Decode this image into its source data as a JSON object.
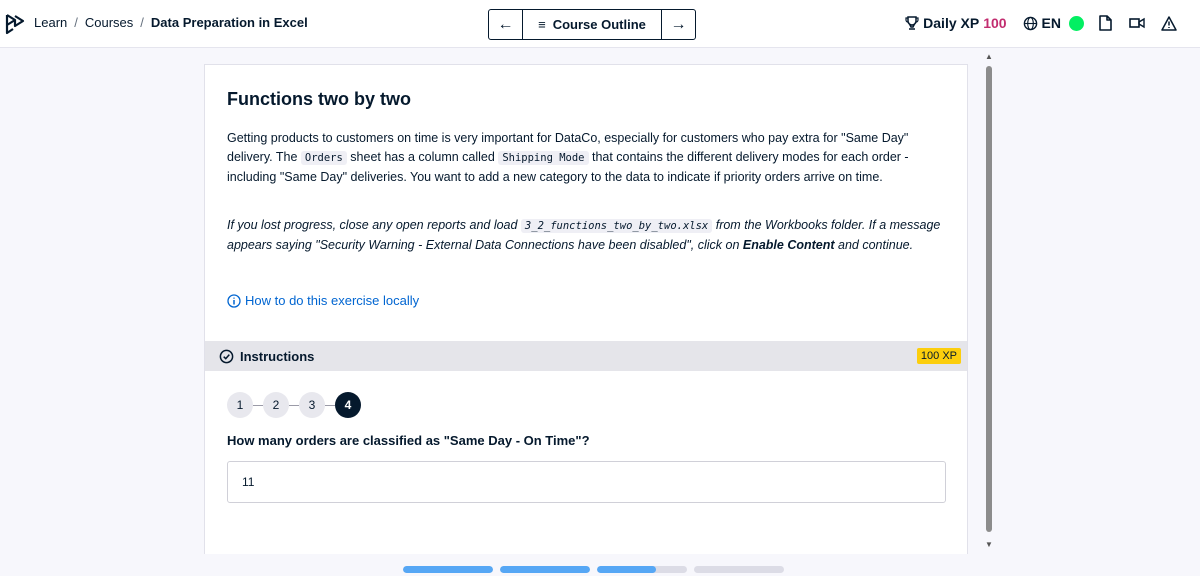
{
  "breadcrumb": {
    "items": [
      "Learn",
      "Courses"
    ],
    "separator": "/",
    "current": "Data Preparation in Excel"
  },
  "nav": {
    "prev_icon": "arrow-left-icon",
    "outline_label": "Course Outline",
    "next_icon": "arrow-right-icon"
  },
  "header": {
    "xp_label": "Daily XP",
    "xp_value": "100",
    "language": "EN",
    "status_color": "#03ef62"
  },
  "exercise": {
    "title": "Functions two by two",
    "p1": {
      "a": "Getting products to customers on time is very important for DataCo, especially for customers who pay extra for \"Same Day\" delivery. The ",
      "code1": "Orders",
      "b": " sheet has a column called ",
      "code2": "Shipping Mode",
      "c": " that contains the different delivery modes for each order - including \"Same Day\" deliveries. You want to add a new category to the data to indicate if priority orders arrive on time."
    },
    "p2": {
      "a": "If you lost progress, close any open reports and load ",
      "code": "3_2_functions_two_by_two.xlsx",
      "b": " from the Workbooks folder. If a message appears saying \"Security Warning - External Data Connections have been disabled\", click on ",
      "bold": "Enable Content",
      "c": " and continue."
    },
    "how_link": "How to do this exercise locally"
  },
  "instructions": {
    "label": "Instructions",
    "xp_badge": "100 XP",
    "steps": [
      "1",
      "2",
      "3",
      "4"
    ],
    "active_step": 4,
    "question": "How many orders are classified as \"Same Day - On Time\"?",
    "answer_value": "11"
  },
  "progress": {
    "segments": [
      1,
      1,
      0.65,
      0
    ]
  },
  "colors": {
    "accent_blue": "#0065d1",
    "xp_pink": "#c22c6f",
    "badge_yellow": "#fcce0d",
    "progress_blue": "#56a7f5"
  }
}
